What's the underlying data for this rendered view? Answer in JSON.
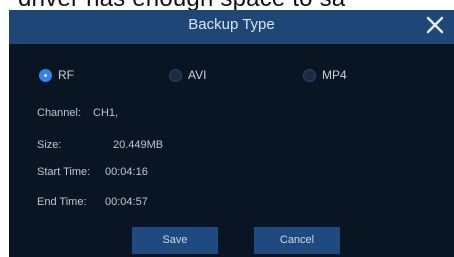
{
  "background_text": "driver has enough space to sa",
  "dialog": {
    "title": "Backup Type",
    "close_icon": "close-icon",
    "backup_formats": [
      {
        "label": "RF",
        "selected": true
      },
      {
        "label": "AVI",
        "selected": false
      },
      {
        "label": "MP4",
        "selected": false
      }
    ],
    "info": {
      "channel_label": "Channel:",
      "channel_value": "CH1,",
      "size_label": "Size:",
      "size_value": "20.449MB",
      "start_time_label": "Start Time:",
      "start_time_value": "00:04:16",
      "end_time_label": "End Time:",
      "end_time_value": "00:04:57"
    },
    "buttons": {
      "save": "Save",
      "cancel": "Cancel"
    }
  },
  "colors": {
    "title_bar": "#1e4677",
    "dialog_background": "#0a1524",
    "button": "#1f4a7f",
    "radio_selected": "#2f86e6"
  }
}
